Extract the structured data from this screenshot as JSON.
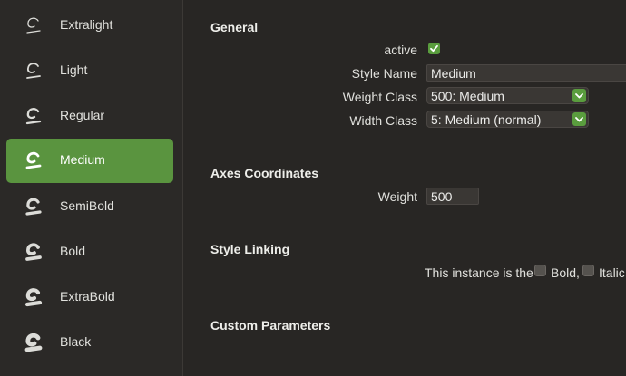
{
  "sidebar": {
    "items": [
      {
        "label": "Extralight",
        "weight": 1
      },
      {
        "label": "Light",
        "weight": 2
      },
      {
        "label": "Regular",
        "weight": 3
      },
      {
        "label": "Medium",
        "weight": 4,
        "selected": true
      },
      {
        "label": "SemiBold",
        "weight": 5
      },
      {
        "label": "Bold",
        "weight": 6
      },
      {
        "label": "ExtraBold",
        "weight": 7
      },
      {
        "label": "Black",
        "weight": 8
      }
    ],
    "icon": "glyph-preview-icon"
  },
  "general": {
    "title": "General",
    "active_label": "active",
    "active_checked": true,
    "style_name_label": "Style Name",
    "style_name_value": "Medium",
    "weight_class_label": "Weight Class",
    "weight_class_value": "500: Medium",
    "width_class_label": "Width Class",
    "width_class_value": "5: Medium (normal)"
  },
  "axes": {
    "title": "Axes Coordinates",
    "weight_label": "Weight",
    "weight_value": "500"
  },
  "style_linking": {
    "title": "Style Linking",
    "instance_text": "This instance is the",
    "bold_label": "Bold,",
    "bold_checked": false,
    "italic_label": "Italic",
    "italic_checked": false
  },
  "custom_parameters": {
    "title": "Custom Parameters"
  },
  "colors": {
    "accent": "#5a943f",
    "checkbox_green": "#5a9d3e",
    "background": "#282624"
  }
}
